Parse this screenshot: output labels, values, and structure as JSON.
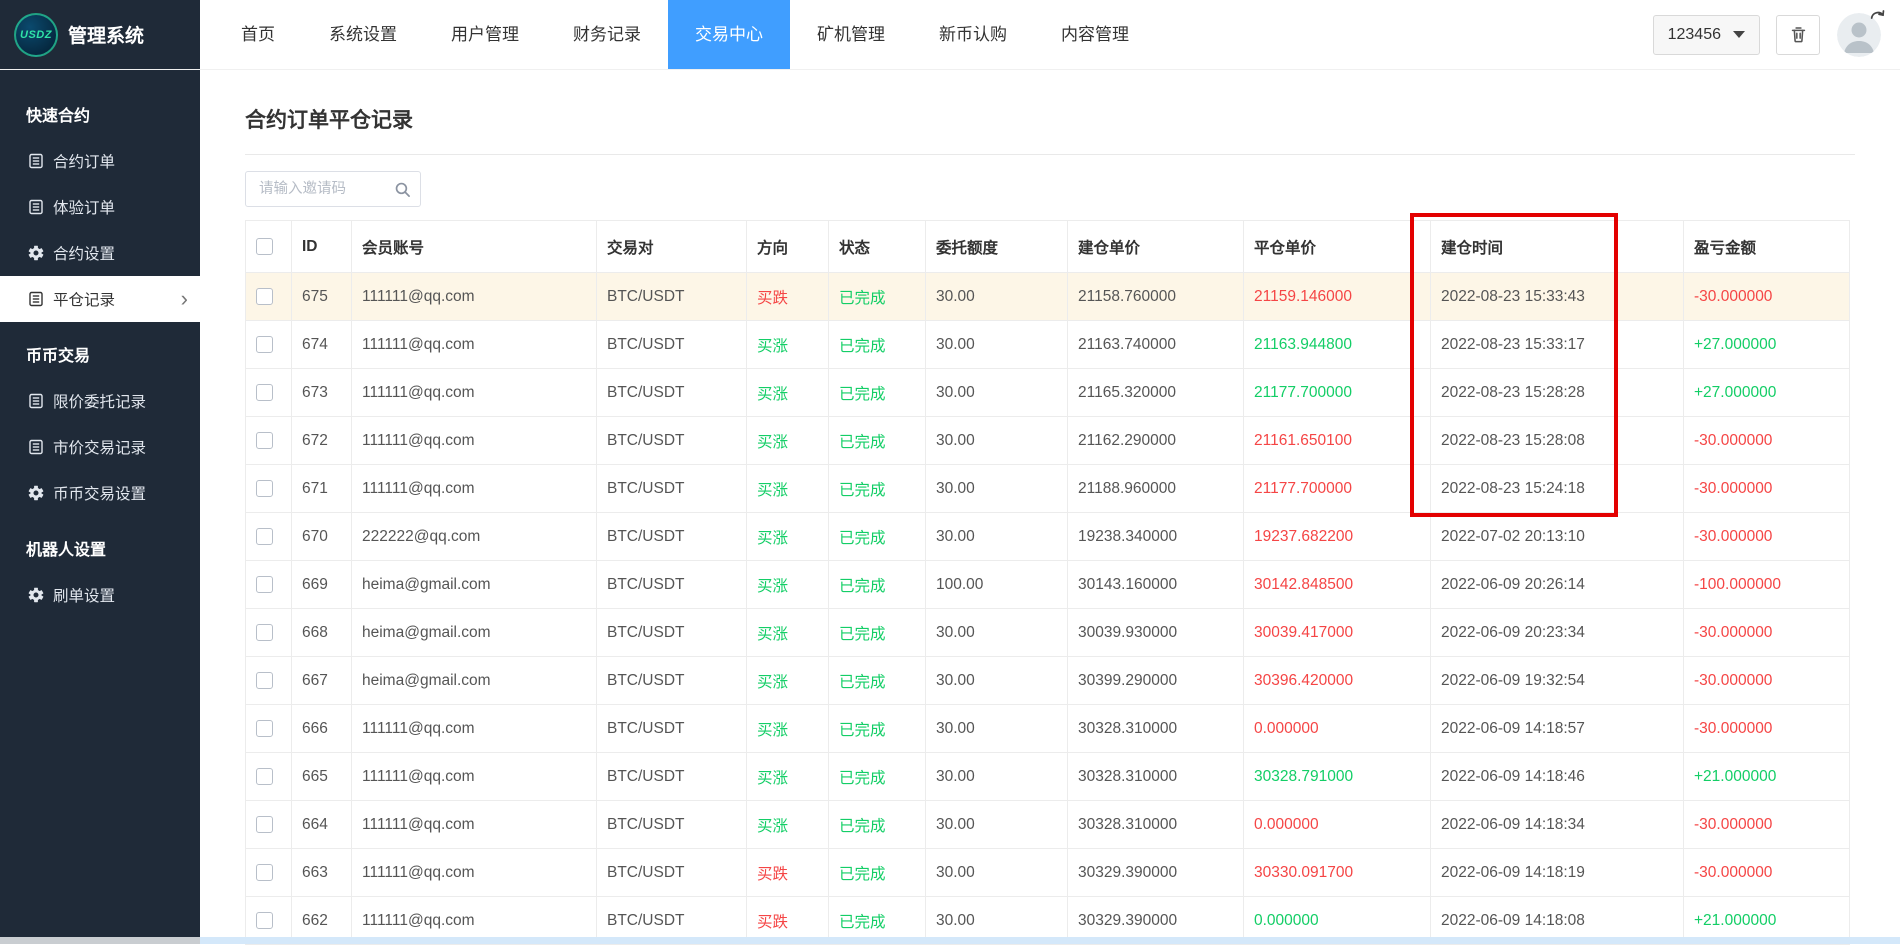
{
  "colors": {
    "accent": "#409eff",
    "red": "#f54545",
    "green": "#13ce66",
    "sidebar_bg": "#1f2a38",
    "highlight_row": "#fdf6e7",
    "annotation": "#e30000",
    "table_border": "#ececec"
  },
  "header": {
    "logo_text": "USDZ",
    "brand": "管理系统",
    "nav": [
      {
        "label": "首页",
        "active": false
      },
      {
        "label": "系统设置",
        "active": false
      },
      {
        "label": "用户管理",
        "active": false
      },
      {
        "label": "财务记录",
        "active": false
      },
      {
        "label": "交易中心",
        "active": true
      },
      {
        "label": "矿机管理",
        "active": false
      },
      {
        "label": "新币认购",
        "active": false
      },
      {
        "label": "内容管理",
        "active": false
      }
    ],
    "user_dropdown": "123456",
    "icons": [
      "caret-down-icon",
      "trash-icon",
      "logout-avatar-icon"
    ]
  },
  "sidebar": {
    "sections": [
      {
        "title": "快速合约",
        "items": [
          {
            "label": "合约订单",
            "icon": "list",
            "active": false
          },
          {
            "label": "体验订单",
            "icon": "list",
            "active": false
          },
          {
            "label": "合约设置",
            "icon": "gear",
            "active": false
          },
          {
            "label": "平仓记录",
            "icon": "list",
            "active": true
          }
        ]
      },
      {
        "title": "币币交易",
        "items": [
          {
            "label": "限价委托记录",
            "icon": "list",
            "active": false
          },
          {
            "label": "市价交易记录",
            "icon": "list",
            "active": false
          },
          {
            "label": "币币交易设置",
            "icon": "gear",
            "active": false
          }
        ]
      },
      {
        "title": "机器人设置",
        "items": [
          {
            "label": "刷单设置",
            "icon": "gear",
            "active": false
          }
        ]
      }
    ]
  },
  "main": {
    "title": "合约订单平仓记录",
    "search_placeholder": "请输入邀请码"
  },
  "table": {
    "headers": [
      "ID",
      "会员账号",
      "交易对",
      "方向",
      "状态",
      "委托额度",
      "建仓单价",
      "平仓单价",
      "建仓时间",
      "盈亏金额"
    ],
    "rows": [
      {
        "id": "675",
        "account": "111111@qq.com",
        "pair": "BTC/USDT",
        "direction": "买跌",
        "direction_color": "red",
        "status": "已完成",
        "status_color": "green",
        "amount": "30.00",
        "open_price": "21158.760000",
        "close_price": "21159.146000",
        "close_price_color": "red",
        "open_time": "2022-08-23 15:33:43",
        "profit": "-30.000000",
        "profit_color": "red",
        "highlighted": true
      },
      {
        "id": "674",
        "account": "111111@qq.com",
        "pair": "BTC/USDT",
        "direction": "买涨",
        "direction_color": "green",
        "status": "已完成",
        "status_color": "green",
        "amount": "30.00",
        "open_price": "21163.740000",
        "close_price": "21163.944800",
        "close_price_color": "green",
        "open_time": "2022-08-23 15:33:17",
        "profit": "+27.000000",
        "profit_color": "green",
        "highlighted": false
      },
      {
        "id": "673",
        "account": "111111@qq.com",
        "pair": "BTC/USDT",
        "direction": "买涨",
        "direction_color": "green",
        "status": "已完成",
        "status_color": "green",
        "amount": "30.00",
        "open_price": "21165.320000",
        "close_price": "21177.700000",
        "close_price_color": "green",
        "open_time": "2022-08-23 15:28:28",
        "profit": "+27.000000",
        "profit_color": "green",
        "highlighted": false
      },
      {
        "id": "672",
        "account": "111111@qq.com",
        "pair": "BTC/USDT",
        "direction": "买涨",
        "direction_color": "green",
        "status": "已完成",
        "status_color": "green",
        "amount": "30.00",
        "open_price": "21162.290000",
        "close_price": "21161.650100",
        "close_price_color": "red",
        "open_time": "2022-08-23 15:28:08",
        "profit": "-30.000000",
        "profit_color": "red",
        "highlighted": false
      },
      {
        "id": "671",
        "account": "111111@qq.com",
        "pair": "BTC/USDT",
        "direction": "买涨",
        "direction_color": "green",
        "status": "已完成",
        "status_color": "green",
        "amount": "30.00",
        "open_price": "21188.960000",
        "close_price": "21177.700000",
        "close_price_color": "red",
        "open_time": "2022-08-23 15:24:18",
        "profit": "-30.000000",
        "profit_color": "red",
        "highlighted": false
      },
      {
        "id": "670",
        "account": "222222@qq.com",
        "pair": "BTC/USDT",
        "direction": "买涨",
        "direction_color": "green",
        "status": "已完成",
        "status_color": "green",
        "amount": "30.00",
        "open_price": "19238.340000",
        "close_price": "19237.682200",
        "close_price_color": "red",
        "open_time": "2022-07-02 20:13:10",
        "profit": "-30.000000",
        "profit_color": "red",
        "highlighted": false
      },
      {
        "id": "669",
        "account": "heima@gmail.com",
        "pair": "BTC/USDT",
        "direction": "买涨",
        "direction_color": "green",
        "status": "已完成",
        "status_color": "green",
        "amount": "100.00",
        "open_price": "30143.160000",
        "close_price": "30142.848500",
        "close_price_color": "red",
        "open_time": "2022-06-09 20:26:14",
        "profit": "-100.000000",
        "profit_color": "red",
        "highlighted": false
      },
      {
        "id": "668",
        "account": "heima@gmail.com",
        "pair": "BTC/USDT",
        "direction": "买涨",
        "direction_color": "green",
        "status": "已完成",
        "status_color": "green",
        "amount": "30.00",
        "open_price": "30039.930000",
        "close_price": "30039.417000",
        "close_price_color": "red",
        "open_time": "2022-06-09 20:23:34",
        "profit": "-30.000000",
        "profit_color": "red",
        "highlighted": false
      },
      {
        "id": "667",
        "account": "heima@gmail.com",
        "pair": "BTC/USDT",
        "direction": "买涨",
        "direction_color": "green",
        "status": "已完成",
        "status_color": "green",
        "amount": "30.00",
        "open_price": "30399.290000",
        "close_price": "30396.420000",
        "close_price_color": "red",
        "open_time": "2022-06-09 19:32:54",
        "profit": "-30.000000",
        "profit_color": "red",
        "highlighted": false
      },
      {
        "id": "666",
        "account": "111111@qq.com",
        "pair": "BTC/USDT",
        "direction": "买涨",
        "direction_color": "green",
        "status": "已完成",
        "status_color": "green",
        "amount": "30.00",
        "open_price": "30328.310000",
        "close_price": "0.000000",
        "close_price_color": "red",
        "open_time": "2022-06-09 14:18:57",
        "profit": "-30.000000",
        "profit_color": "red",
        "highlighted": false
      },
      {
        "id": "665",
        "account": "111111@qq.com",
        "pair": "BTC/USDT",
        "direction": "买涨",
        "direction_color": "green",
        "status": "已完成",
        "status_color": "green",
        "amount": "30.00",
        "open_price": "30328.310000",
        "close_price": "30328.791000",
        "close_price_color": "green",
        "open_time": "2022-06-09 14:18:46",
        "profit": "+21.000000",
        "profit_color": "green",
        "highlighted": false
      },
      {
        "id": "664",
        "account": "111111@qq.com",
        "pair": "BTC/USDT",
        "direction": "买涨",
        "direction_color": "green",
        "status": "已完成",
        "status_color": "green",
        "amount": "30.00",
        "open_price": "30328.310000",
        "close_price": "0.000000",
        "close_price_color": "red",
        "open_time": "2022-06-09 14:18:34",
        "profit": "-30.000000",
        "profit_color": "red",
        "highlighted": false
      },
      {
        "id": "663",
        "account": "111111@qq.com",
        "pair": "BTC/USDT",
        "direction": "买跌",
        "direction_color": "red",
        "status": "已完成",
        "status_color": "green",
        "amount": "30.00",
        "open_price": "30329.390000",
        "close_price": "30330.091700",
        "close_price_color": "red",
        "open_time": "2022-06-09 14:18:19",
        "profit": "-30.000000",
        "profit_color": "red",
        "highlighted": false
      },
      {
        "id": "662",
        "account": "111111@qq.com",
        "pair": "BTC/USDT",
        "direction": "买跌",
        "direction_color": "red",
        "status": "已完成",
        "status_color": "green",
        "amount": "30.00",
        "open_price": "30329.390000",
        "close_price": "0.000000",
        "close_price_color": "green",
        "open_time": "2022-06-09 14:18:08",
        "profit": "+21.000000",
        "profit_color": "green",
        "highlighted": false
      }
    ]
  }
}
